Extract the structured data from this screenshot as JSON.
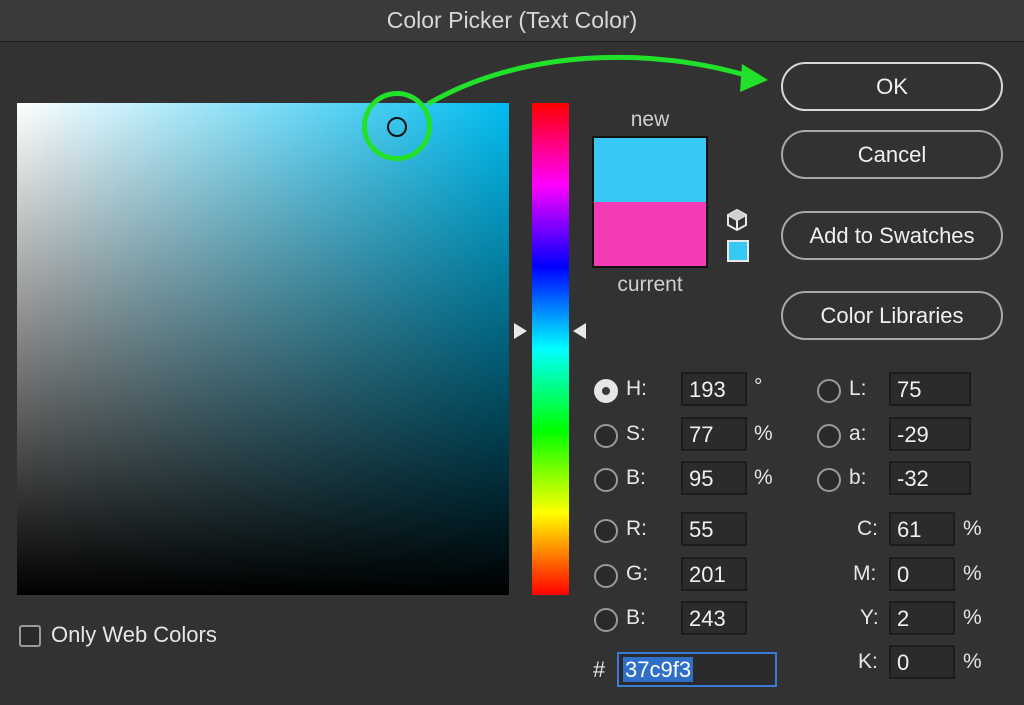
{
  "window": {
    "title": "Color Picker (Text Color)"
  },
  "preview": {
    "new_label": "new",
    "current_label": "current",
    "new_color": "#37c9f3",
    "current_color": "#f53ab5"
  },
  "buttons": {
    "ok": "OK",
    "cancel": "Cancel",
    "add_to_swatches": "Add to Swatches",
    "color_libraries": "Color Libraries"
  },
  "hsb": {
    "h": {
      "label": "H:",
      "value": "193",
      "unit": "°",
      "selected": true
    },
    "s": {
      "label": "S:",
      "value": "77",
      "unit": "%"
    },
    "b": {
      "label": "B:",
      "value": "95",
      "unit": "%"
    }
  },
  "rgb": {
    "r": {
      "label": "R:",
      "value": "55"
    },
    "g": {
      "label": "G:",
      "value": "201"
    },
    "b": {
      "label": "B:",
      "value": "243"
    }
  },
  "lab": {
    "l": {
      "label": "L:",
      "value": "75"
    },
    "a": {
      "label": "a:",
      "value": "-29"
    },
    "b": {
      "label": "b:",
      "value": "-32"
    }
  },
  "cmyk": {
    "c": {
      "label": "C:",
      "value": "61",
      "unit": "%"
    },
    "m": {
      "label": "M:",
      "value": "0",
      "unit": "%"
    },
    "y": {
      "label": "Y:",
      "value": "2",
      "unit": "%"
    },
    "k": {
      "label": "K:",
      "value": "0",
      "unit": "%"
    }
  },
  "hex": {
    "prefix": "#",
    "value": "37c9f3"
  },
  "web_colors": {
    "label": "Only Web Colors",
    "checked": false
  },
  "accent": {
    "highlight": "#22e12a",
    "selection": "#2f6fc8"
  },
  "icons": {
    "gamut": "cube-icon",
    "web_safe": "web-swatch-icon"
  }
}
